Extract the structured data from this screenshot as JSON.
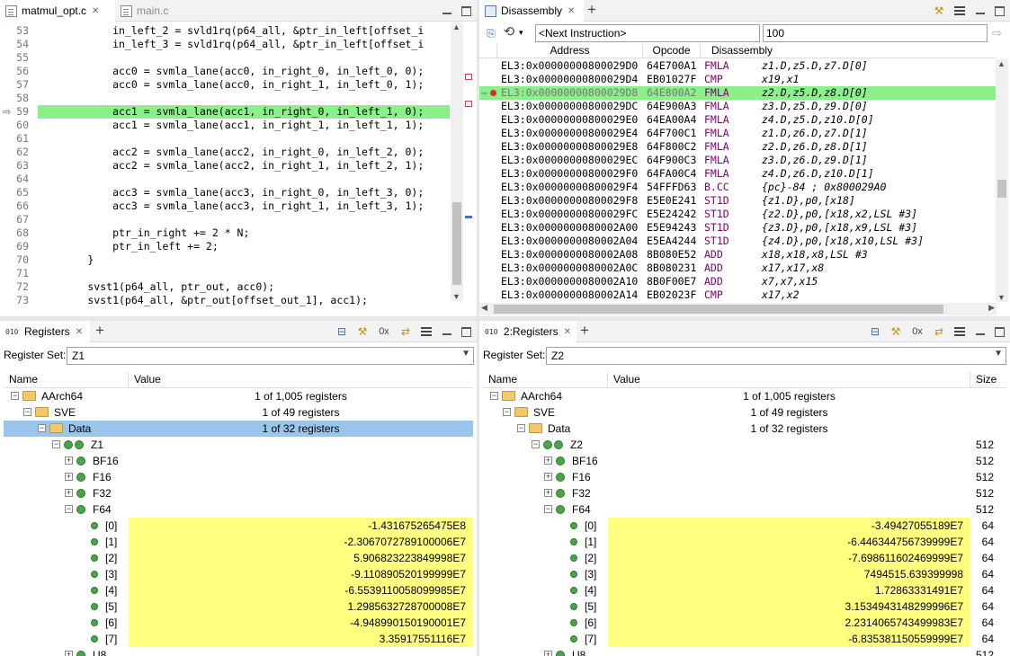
{
  "editor": {
    "tabs": [
      {
        "label": "matmul_opt.c",
        "active": true
      },
      {
        "label": "main.c",
        "active": false
      }
    ],
    "lines": [
      {
        "num": "53",
        "code": "            in_left_2 = svld1rq(p64_all, &ptr_in_left[offset_i"
      },
      {
        "num": "54",
        "code": "            in_left_3 = svld1rq(p64_all, &ptr_in_left[offset_i"
      },
      {
        "num": "55",
        "code": ""
      },
      {
        "num": "56",
        "code": "            acc0 = svmla_lane(acc0, in_right_0, in_left_0, 0);"
      },
      {
        "num": "57",
        "code": "            acc0 = svmla_lane(acc0, in_right_1, in_left_0, 1);"
      },
      {
        "num": "58",
        "code": ""
      },
      {
        "num": "59",
        "code": "            acc1 = svmla_lane(acc1, in_right_0, in_left_1, 0);"
      },
      {
        "num": "60",
        "code": "            acc1 = svmla_lane(acc1, in_right_1, in_left_1, 1);"
      },
      {
        "num": "61",
        "code": ""
      },
      {
        "num": "62",
        "code": "            acc2 = svmla_lane(acc2, in_right_0, in_left_2, 0);"
      },
      {
        "num": "63",
        "code": "            acc2 = svmla_lane(acc2, in_right_1, in_left_2, 1);"
      },
      {
        "num": "64",
        "code": ""
      },
      {
        "num": "65",
        "code": "            acc3 = svmla_lane(acc3, in_right_0, in_left_3, 0);"
      },
      {
        "num": "66",
        "code": "            acc3 = svmla_lane(acc3, in_right_1, in_left_3, 1);"
      },
      {
        "num": "67",
        "code": ""
      },
      {
        "num": "68",
        "code": "            ptr_in_right += 2 * N;"
      },
      {
        "num": "69",
        "code": "            ptr_in_left += 2;"
      },
      {
        "num": "70",
        "code": "        }"
      },
      {
        "num": "71",
        "code": ""
      },
      {
        "num": "72",
        "code": "        svst1(p64_all, ptr_out, acc0);"
      },
      {
        "num": "73",
        "code": "        svst1(p64_all, &ptr_out[offset_out_1], acc1);"
      }
    ],
    "current_line_index": 6
  },
  "disassembly": {
    "tab_label": "Disassembly",
    "address_input": "<Next Instruction>",
    "count_input": "100",
    "columns": [
      "Address",
      "Opcode",
      "Disassembly"
    ],
    "rows": [
      {
        "addr": "EL3:0x00000000800029D0",
        "op": "64E700A1",
        "mn": "FMLA",
        "args": "z1.D,z5.D,z7.D[0]"
      },
      {
        "addr": "EL3:0x00000000800029D4",
        "op": "EB01027F",
        "mn": "CMP",
        "args": "x19,x1"
      },
      {
        "addr": "EL3:0x00000000800029D8",
        "op": "64E800A2",
        "mn": "FMLA",
        "args": "z2.D,z5.D,z8.D[0]"
      },
      {
        "addr": "EL3:0x00000000800029DC",
        "op": "64E900A3",
        "mn": "FMLA",
        "args": "z3.D,z5.D,z9.D[0]"
      },
      {
        "addr": "EL3:0x00000000800029E0",
        "op": "64EA00A4",
        "mn": "FMLA",
        "args": "z4.D,z5.D,z10.D[0]"
      },
      {
        "addr": "EL3:0x00000000800029E4",
        "op": "64F700C1",
        "mn": "FMLA",
        "args": "z1.D,z6.D,z7.D[1]"
      },
      {
        "addr": "EL3:0x00000000800029E8",
        "op": "64F800C2",
        "mn": "FMLA",
        "args": "z2.D,z6.D,z8.D[1]"
      },
      {
        "addr": "EL3:0x00000000800029EC",
        "op": "64F900C3",
        "mn": "FMLA",
        "args": "z3.D,z6.D,z9.D[1]"
      },
      {
        "addr": "EL3:0x00000000800029F0",
        "op": "64FA00C4",
        "mn": "FMLA",
        "args": "z4.D,z6.D,z10.D[1]"
      },
      {
        "addr": "EL3:0x00000000800029F4",
        "op": "54FFFD63",
        "mn": "B.CC",
        "args": "{pc}-84 ; 0x800029A0"
      },
      {
        "addr": "EL3:0x00000000800029F8",
        "op": "E5E0E241",
        "mn": "ST1D",
        "args": "{z1.D},p0,[x18]"
      },
      {
        "addr": "EL3:0x00000000800029FC",
        "op": "E5E24242",
        "mn": "ST1D",
        "args": "{z2.D},p0,[x18,x2,LSL #3]"
      },
      {
        "addr": "EL3:0x0000000080002A00",
        "op": "E5E94243",
        "mn": "ST1D",
        "args": "{z3.D},p0,[x18,x9,LSL #3]"
      },
      {
        "addr": "EL3:0x0000000080002A04",
        "op": "E5EA4244",
        "mn": "ST1D",
        "args": "{z4.D},p0,[x18,x10,LSL #3]"
      },
      {
        "addr": "EL3:0x0000000080002A08",
        "op": "8B080E52",
        "mn": "ADD",
        "args": "x18,x18,x8,LSL #3"
      },
      {
        "addr": "EL3:0x0000000080002A0C",
        "op": "8B080231",
        "mn": "ADD",
        "args": "x17,x17,x8"
      },
      {
        "addr": "EL3:0x0000000080002A10",
        "op": "8B0F00E7",
        "mn": "ADD",
        "args": "x7,x7,x15"
      },
      {
        "addr": "EL3:0x0000000080002A14",
        "op": "EB02023F",
        "mn": "CMP",
        "args": "x17,x2"
      }
    ],
    "current_row_index": 2
  },
  "registers1": {
    "tab_label": "Registers",
    "set_label": "Register Set:",
    "set_value": "Z1",
    "columns": [
      "Name",
      "Value"
    ],
    "rows": [
      {
        "name": "AArch64",
        "value": "1 of 1,005 registers",
        "level": 0,
        "icon": "folder",
        "exp": "-"
      },
      {
        "name": "SVE",
        "value": "1 of 49 registers",
        "level": 1,
        "icon": "folder",
        "exp": "-"
      },
      {
        "name": "Data",
        "value": "1 of 32 registers",
        "level": 2,
        "icon": "folder",
        "exp": "-",
        "selected": true
      },
      {
        "name": "Z1",
        "value": "",
        "level": 3,
        "icon": "gem2",
        "exp": "-"
      },
      {
        "name": "BF16",
        "value": "",
        "level": 4,
        "icon": "gem",
        "exp": "+"
      },
      {
        "name": "F16",
        "value": "",
        "level": 4,
        "icon": "gem",
        "exp": "+"
      },
      {
        "name": "F32",
        "value": "",
        "level": 4,
        "icon": "gem",
        "exp": "+"
      },
      {
        "name": "F64",
        "value": "",
        "level": 4,
        "icon": "gem",
        "exp": "-"
      },
      {
        "name": "[0]",
        "value": "-1.431675265475E8",
        "level": 5,
        "icon": "dot",
        "num": true
      },
      {
        "name": "[1]",
        "value": "-2.3067072789100006E7",
        "level": 5,
        "icon": "dot",
        "num": true
      },
      {
        "name": "[2]",
        "value": "5.906823223849998E7",
        "level": 5,
        "icon": "dot",
        "num": true
      },
      {
        "name": "[3]",
        "value": "-9.110890520199999E7",
        "level": 5,
        "icon": "dot",
        "num": true
      },
      {
        "name": "[4]",
        "value": "-6.5539110058099985E7",
        "level": 5,
        "icon": "dot",
        "num": true
      },
      {
        "name": "[5]",
        "value": "1.2985632728700008E7",
        "level": 5,
        "icon": "dot",
        "num": true
      },
      {
        "name": "[6]",
        "value": "-4.948990150190001E7",
        "level": 5,
        "icon": "dot",
        "num": true
      },
      {
        "name": "[7]",
        "value": "3.35917551116E7",
        "level": 5,
        "icon": "dot",
        "num": true
      },
      {
        "name": "U8",
        "value": "",
        "level": 4,
        "icon": "gem",
        "exp": "+"
      }
    ]
  },
  "registers2": {
    "tab_label": "2:Registers",
    "set_label": "Register Set:",
    "set_value": "Z2",
    "columns": [
      "Name",
      "Value",
      "Size"
    ],
    "rows": [
      {
        "name": "AArch64",
        "value": "1 of 1,005 registers",
        "size": "",
        "level": 0,
        "icon": "folder",
        "exp": "-"
      },
      {
        "name": "SVE",
        "value": "1 of 49 registers",
        "size": "",
        "level": 1,
        "icon": "folder",
        "exp": "-"
      },
      {
        "name": "Data",
        "value": "1 of 32 registers",
        "size": "",
        "level": 2,
        "icon": "folder",
        "exp": "-"
      },
      {
        "name": "Z2",
        "value": "",
        "size": "512",
        "level": 3,
        "icon": "gem2",
        "exp": "-"
      },
      {
        "name": "BF16",
        "value": "",
        "size": "512",
        "level": 4,
        "icon": "gem",
        "exp": "+"
      },
      {
        "name": "F16",
        "value": "",
        "size": "512",
        "level": 4,
        "icon": "gem",
        "exp": "+"
      },
      {
        "name": "F32",
        "value": "",
        "size": "512",
        "level": 4,
        "icon": "gem",
        "exp": "+"
      },
      {
        "name": "F64",
        "value": "",
        "size": "512",
        "level": 4,
        "icon": "gem",
        "exp": "-"
      },
      {
        "name": "[0]",
        "value": "-3.49427055189E7",
        "size": "64",
        "level": 5,
        "icon": "dot",
        "num": true
      },
      {
        "name": "[1]",
        "value": "-6.446344756739999E7",
        "size": "64",
        "level": 5,
        "icon": "dot",
        "num": true
      },
      {
        "name": "[2]",
        "value": "-7.698611602469999E7",
        "size": "64",
        "level": 5,
        "icon": "dot",
        "num": true
      },
      {
        "name": "[3]",
        "value": "7494515.639399998",
        "size": "64",
        "level": 5,
        "icon": "dot",
        "num": true
      },
      {
        "name": "[4]",
        "value": "1.72863331491E7",
        "size": "64",
        "level": 5,
        "icon": "dot",
        "num": true
      },
      {
        "name": "[5]",
        "value": "3.1534943148299996E7",
        "size": "64",
        "level": 5,
        "icon": "dot",
        "num": true
      },
      {
        "name": "[6]",
        "value": "2.2314065743499983E7",
        "size": "64",
        "level": 5,
        "icon": "dot",
        "num": true
      },
      {
        "name": "[7]",
        "value": "-6.835381150559999E7",
        "size": "64",
        "level": 5,
        "icon": "dot",
        "num": true
      },
      {
        "name": "U8",
        "value": "",
        "size": "512",
        "level": 4,
        "icon": "gem",
        "exp": "+"
      }
    ]
  },
  "toolbar": {
    "hex_label": "0x"
  },
  "colors": {
    "current_line": "#8af08a",
    "selection": "#9ac5ec",
    "value_highlight": "#ffff80",
    "mnemonic": "#7a0070"
  }
}
